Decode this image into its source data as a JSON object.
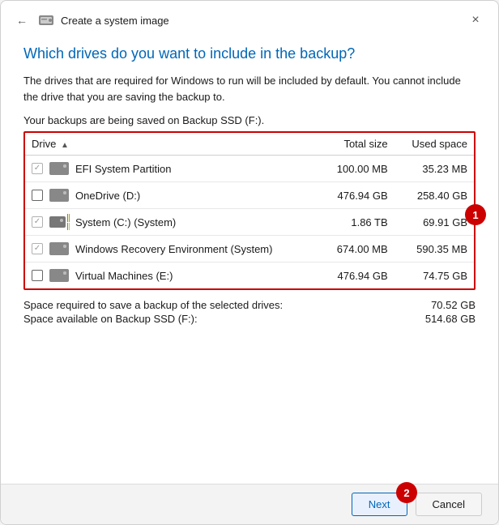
{
  "window": {
    "title": "Create a system image",
    "close_label": "×"
  },
  "back_btn_symbol": "←",
  "heading": "Which drives do you want to include in the backup?",
  "description": "The drives that are required for Windows to run will be included by default. You cannot include the drive that you are saving the backup to.",
  "backup_location": "Your backups are being saved on Backup SSD (F:).",
  "table": {
    "col_drive": "Drive",
    "col_total": "Total size",
    "col_used": "Used space",
    "rows": [
      {
        "checked": true,
        "disabled": true,
        "drive_type": "hdd",
        "name": "EFI System Partition",
        "total": "100.00 MB",
        "used": "35.23 MB"
      },
      {
        "checked": false,
        "disabled": false,
        "drive_type": "hdd",
        "name": "OneDrive (D:)",
        "total": "476.94 GB",
        "used": "258.40 GB"
      },
      {
        "checked": true,
        "disabled": true,
        "drive_type": "win",
        "name": "System (C:) (System)",
        "total": "1.86 TB",
        "used": "69.91 GB"
      },
      {
        "checked": true,
        "disabled": true,
        "drive_type": "hdd",
        "name": "Windows Recovery Environment (System)",
        "total": "674.00 MB",
        "used": "590.35 MB"
      },
      {
        "checked": false,
        "disabled": false,
        "drive_type": "hdd",
        "name": "Virtual Machines (E:)",
        "total": "476.94 GB",
        "used": "74.75 GB"
      }
    ]
  },
  "space": {
    "required_label": "Space required to save a backup of the selected drives:",
    "required_value": "70.52 GB",
    "available_label": "Space available on Backup SSD (F:):",
    "available_value": "514.68 GB"
  },
  "buttons": {
    "next": "Next",
    "cancel": "Cancel"
  },
  "badges": {
    "one": "1",
    "two": "2"
  }
}
